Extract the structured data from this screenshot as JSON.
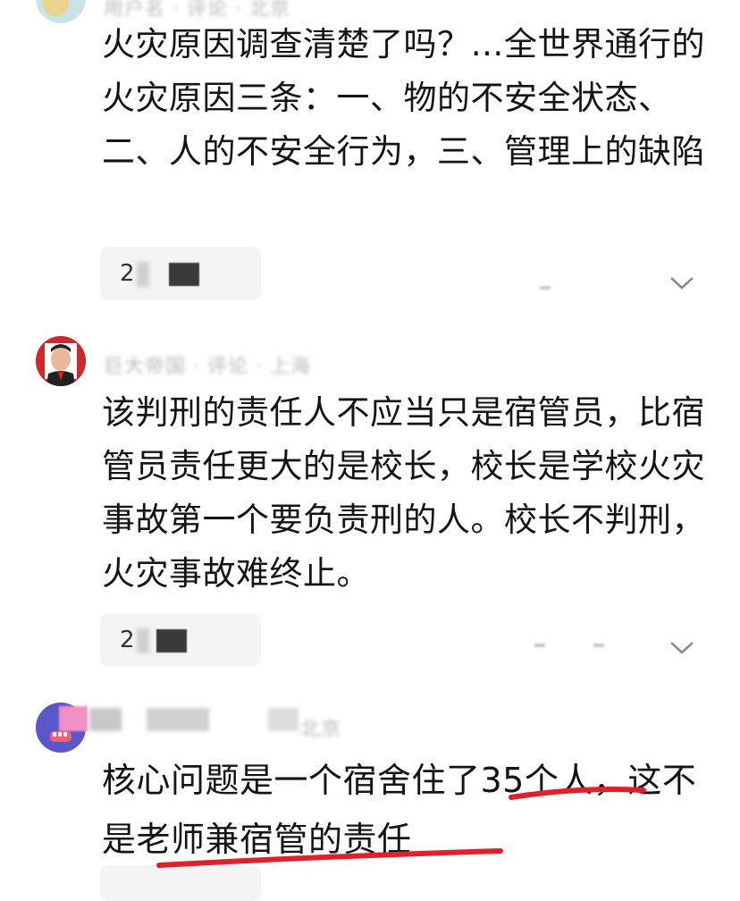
{
  "comments": [
    {
      "meta_blurred": "用户名  · 评论 ·  北京",
      "text": "火灾原因调查清楚了吗？…全世界通行的火灾原因三条：一、物的不安全状态、二、人的不安全行为，三、管理上的缺陷",
      "reply_count": "2"
    },
    {
      "meta_blurred": "巨大帝国  · 评论 ·  上海",
      "text": "该判刑的责任人不应当只是宿管员，比宿管员责任更大的是校长，校长是学校火灾事故第一个要负责刑的人。校长不判刑，火灾事故难终止。",
      "reply_count": "2"
    },
    {
      "meta_blurred": "  北京",
      "text": "核心问题是一个宿舍住了35个人，这不是老师兼宿管的责任",
      "reply_count": ""
    }
  ],
  "colors": {
    "underline": "#e0202b",
    "pill_bg": "#f4f4f4",
    "text": "#141414"
  },
  "icons": [
    "expand-chevron-icon",
    "avatar"
  ]
}
